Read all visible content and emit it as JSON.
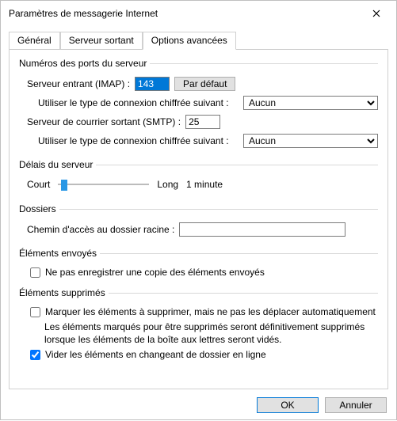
{
  "window": {
    "title": "Paramètres de messagerie Internet"
  },
  "tabs": {
    "general": "Général",
    "outgoing": "Serveur sortant",
    "advanced": "Options avancées"
  },
  "groups": {
    "ports": {
      "legend": "Numéros des ports du serveur",
      "imap_label": "Serveur entrant (IMAP) :",
      "imap_value": "143",
      "default_btn": "Par défaut",
      "enc_label": "Utiliser le type de connexion chiffrée suivant :",
      "enc_imap_value": "Aucun",
      "smtp_label": "Serveur de courrier sortant (SMTP) :",
      "smtp_value": "25",
      "enc_smtp_value": "Aucun"
    },
    "timeouts": {
      "legend": "Délais du serveur",
      "short": "Court",
      "long": "Long",
      "value": "1 minute"
    },
    "folders": {
      "legend": "Dossiers",
      "root_label": "Chemin d'accès au dossier racine :",
      "root_value": ""
    },
    "sent": {
      "legend": "Éléments envoyés",
      "no_copy": "Ne pas enregistrer une copie des éléments envoyés"
    },
    "deleted": {
      "legend": "Éléments supprimés",
      "mark": "Marquer les éléments à supprimer, mais ne pas les déplacer automatiquement",
      "mark_desc": "Les éléments marqués pour être supprimés seront définitivement supprimés lorsque les éléments de la boîte aux lettres seront vidés.",
      "purge": "Vider les éléments en changeant de dossier en ligne"
    }
  },
  "footer": {
    "ok": "OK",
    "cancel": "Annuler"
  }
}
